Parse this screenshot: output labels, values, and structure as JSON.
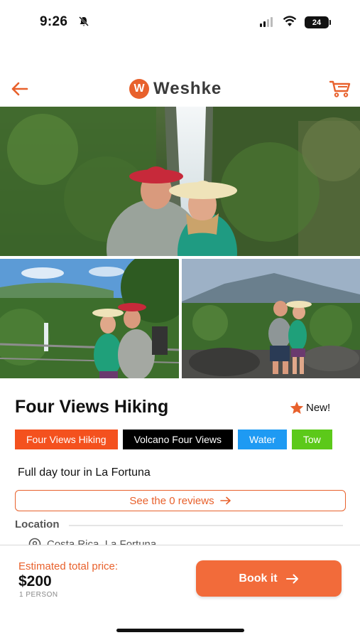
{
  "status_bar": {
    "time": "9:26",
    "battery": "24"
  },
  "header": {
    "brand_name": "Weshke",
    "brand_mark": "W",
    "back_icon": "arrow-left-icon",
    "cart_icon": "cart-icon",
    "accent_color": "#e8612c"
  },
  "gallery": {
    "photos": [
      {
        "name": "waterfall-couple-photo"
      },
      {
        "name": "lookout-couple-photo"
      },
      {
        "name": "volcano-couple-photo"
      }
    ]
  },
  "tour": {
    "title": "Four Views Hiking",
    "badge": "New!",
    "badge_icon": "star-icon",
    "tags": [
      {
        "label": "Four Views Hiking",
        "bg": "#f4511e",
        "color": "#ffffff"
      },
      {
        "label": "Volcano Four Views",
        "bg": "#000000",
        "color": "#ffffff"
      },
      {
        "label": "Water",
        "bg": "#1e9af3",
        "color": "#ffffff"
      },
      {
        "label": "Tow",
        "bg": "#5cc91a",
        "color": "#ffffff"
      }
    ],
    "subtitle": "Full day tour in La Fortuna",
    "reviews_button": "See the 0 reviews",
    "location_label": "Location",
    "location_value": "Costa Rica, La Fortuna"
  },
  "booking": {
    "price_label": "Estimated total price:",
    "price": "$200",
    "persons": "1 PERSON",
    "book_button": "Book it"
  }
}
